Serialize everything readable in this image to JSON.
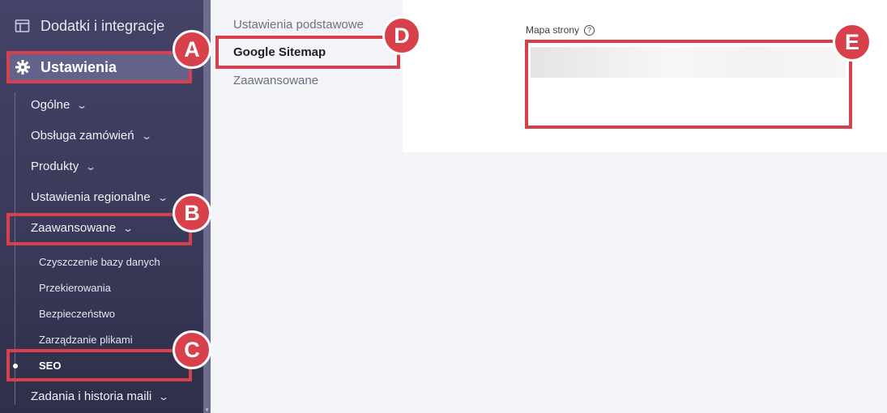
{
  "sidebar": {
    "top_item": "Dodatki i integracje",
    "active_item": "Ustawienia",
    "items": [
      {
        "label": "Ogólne"
      },
      {
        "label": "Obsługa zamówień"
      },
      {
        "label": "Produkty"
      },
      {
        "label": "Ustawienia regionalne"
      },
      {
        "label": "Zaawansowane"
      }
    ],
    "subitems": [
      {
        "label": "Czyszczenie bazy danych"
      },
      {
        "label": "Przekierowania"
      },
      {
        "label": "Bezpieczeństwo"
      },
      {
        "label": "Zarządzanie plikami"
      },
      {
        "label": "SEO"
      }
    ],
    "bottom_item": "Zadania i historia maili"
  },
  "subnav": {
    "items": [
      {
        "label": "Ustawienia podstawowe"
      },
      {
        "label": "Google Sitemap"
      },
      {
        "label": "Zaawansowane"
      }
    ]
  },
  "content": {
    "field_label": "Mapa strony"
  },
  "annotations": [
    "A",
    "B",
    "C",
    "D",
    "E"
  ],
  "colors": {
    "sidebar_bg": "#3e3d5e",
    "active_bg": "#64628a",
    "highlight": "#d8414b",
    "page_bg": "#f3f4f8"
  }
}
